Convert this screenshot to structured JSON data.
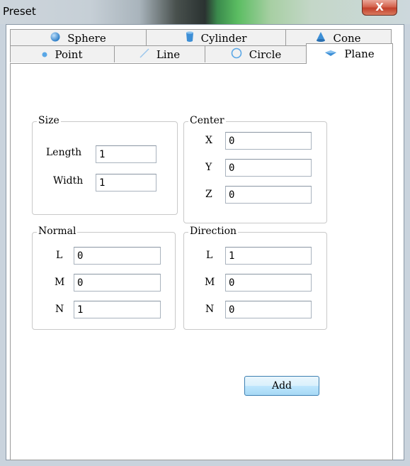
{
  "window": {
    "title": "Preset",
    "close_symbol": "X"
  },
  "tabs_row1": [
    {
      "label": "Sphere",
      "icon": "sphere-icon"
    },
    {
      "label": "Cylinder",
      "icon": "cylinder-icon"
    },
    {
      "label": "Cone",
      "icon": "cone-icon"
    }
  ],
  "tabs_row2": [
    {
      "label": "Point",
      "icon": "point-icon"
    },
    {
      "label": "Line",
      "icon": "line-icon"
    },
    {
      "label": "Circle",
      "icon": "circle-icon"
    },
    {
      "label": "Plane",
      "icon": "plane-icon",
      "selected": true
    }
  ],
  "size": {
    "legend": "Size",
    "length_label": "Length",
    "length_value": "1",
    "width_label": "Width",
    "width_value": "1"
  },
  "center": {
    "legend": "Center",
    "x_label": "X",
    "x_value": "0",
    "y_label": "Y",
    "y_value": "0",
    "z_label": "Z",
    "z_value": "0"
  },
  "normal": {
    "legend": "Normal",
    "l_label": "L",
    "l_value": "0",
    "m_label": "M",
    "m_value": "0",
    "n_label": "N",
    "n_value": "1"
  },
  "direction": {
    "legend": "Direction",
    "l_label": "L",
    "l_value": "1",
    "m_label": "M",
    "m_value": "0",
    "n_label": "N",
    "n_value": "0"
  },
  "add_label": "Add",
  "colors": {
    "icon_blue": "#3d8fd6",
    "selected_tab": "#ffffff",
    "tab": "#f1f1f1"
  }
}
